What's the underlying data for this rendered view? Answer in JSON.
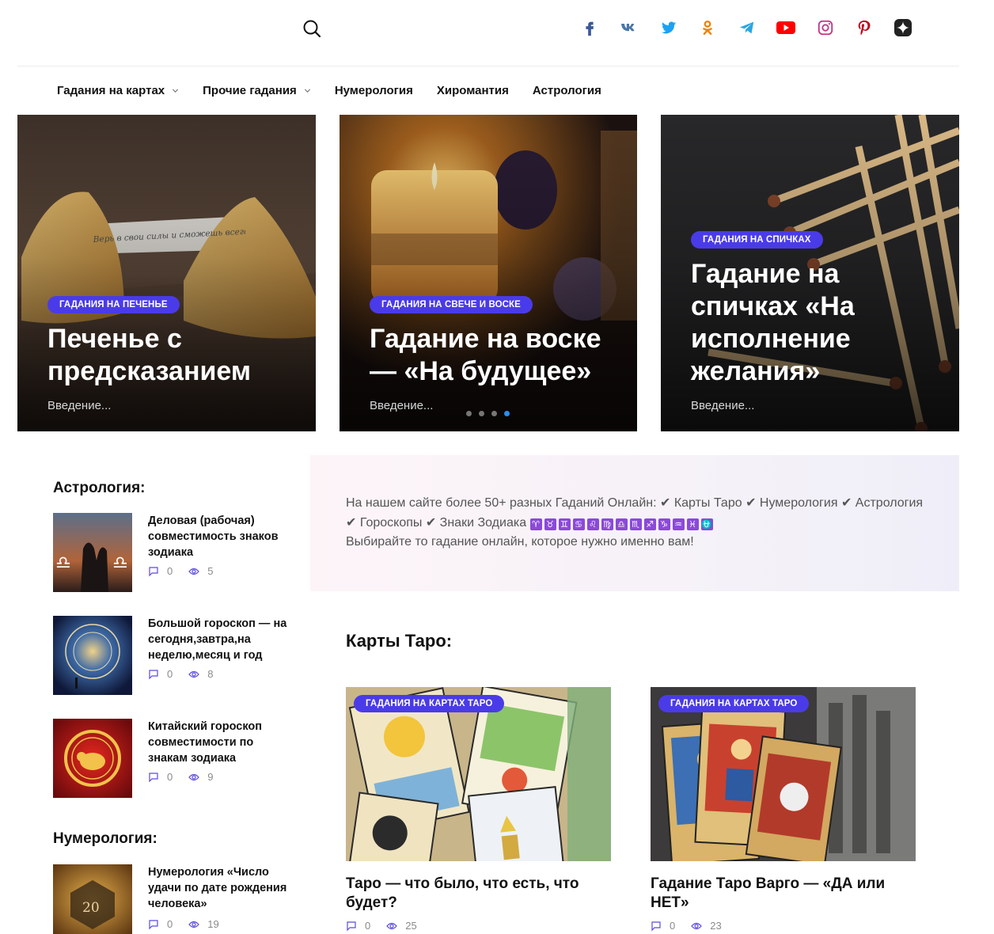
{
  "header": {
    "social": [
      {
        "name": "facebook-icon",
        "color": "#3b5998"
      },
      {
        "name": "vk-icon",
        "color": "#4a76a8"
      },
      {
        "name": "twitter-icon",
        "color": "#1da1f2"
      },
      {
        "name": "odnoklassniki-icon",
        "color": "#ee8208"
      },
      {
        "name": "telegram-icon",
        "color": "#2ca5e0"
      },
      {
        "name": "youtube-icon",
        "color": "#ff0000"
      },
      {
        "name": "instagram-icon",
        "color": "#c13584"
      },
      {
        "name": "pinterest-icon",
        "color": "#bd081c"
      },
      {
        "name": "yandex-zen-icon",
        "color": "#222222"
      }
    ]
  },
  "nav": {
    "items": [
      {
        "label": "Гадания на картах",
        "has_dropdown": true
      },
      {
        "label": "Прочие гадания",
        "has_dropdown": true
      },
      {
        "label": "Нумерология",
        "has_dropdown": false
      },
      {
        "label": "Хиромантия",
        "has_dropdown": false
      },
      {
        "label": "Астрология",
        "has_dropdown": false
      }
    ]
  },
  "hero": [
    {
      "badge": "Гадания на печенье",
      "title": "Печенье с предсказанием",
      "excerpt": "Введение...",
      "note": "Верь в свои силы и сможешь всего добиться."
    },
    {
      "badge": "Гадания на свече и воске",
      "title": "Гадание на воске — «На будущее»",
      "excerpt": "Введение..."
    },
    {
      "badge": "Гадания на спичках",
      "title": "Гадание на спичках «На исполнение желания»",
      "excerpt": "Введение..."
    }
  ],
  "slider": {
    "total": 4,
    "active": 4
  },
  "sidebar": {
    "astro_heading": "Астрология:",
    "astro": [
      {
        "title": "Деловая (рабочая) совместимость знаков зодиака",
        "comments": "0",
        "views": "5"
      },
      {
        "title": "Большой гороскоп — на сегодня,завтра,на неделю,месяц и год",
        "comments": "0",
        "views": "8"
      },
      {
        "title": "Китайский гороскоп совместимости по знакам зодиака",
        "comments": "0",
        "views": "9"
      }
    ],
    "num_heading": "Нумерология:",
    "num": [
      {
        "title": "Нумерология «Число удачи по дате рождения человека»",
        "comments": "0",
        "views": "19"
      }
    ]
  },
  "promo": {
    "text_a": "На нашем сайте более 50+ разных Гаданий Онлайн: ✔ Карты Таро ✔ Нумерология ✔ Астрология ✔ Гороскопы ✔ Знаки Зодиака ",
    "zodiac": [
      "♈",
      "♉",
      "♊",
      "♋",
      "♌",
      "♍",
      "♎",
      "♏",
      "♐",
      "♑",
      "♒",
      "♓",
      "⛎"
    ],
    "text_b": "Выбирайте то гадание онлайн, которое нужно именно вам!"
  },
  "tarot": {
    "heading": "Карты Таро:",
    "cards": [
      {
        "badge": "Гадания на картах таро",
        "title": "Таро — что было, что есть, что будет?",
        "comments": "0",
        "views": "25"
      },
      {
        "badge": "Гадания на картах таро",
        "title": "Гадание Таро Варго — «ДА или НЕТ»",
        "comments": "0",
        "views": "23"
      }
    ]
  }
}
